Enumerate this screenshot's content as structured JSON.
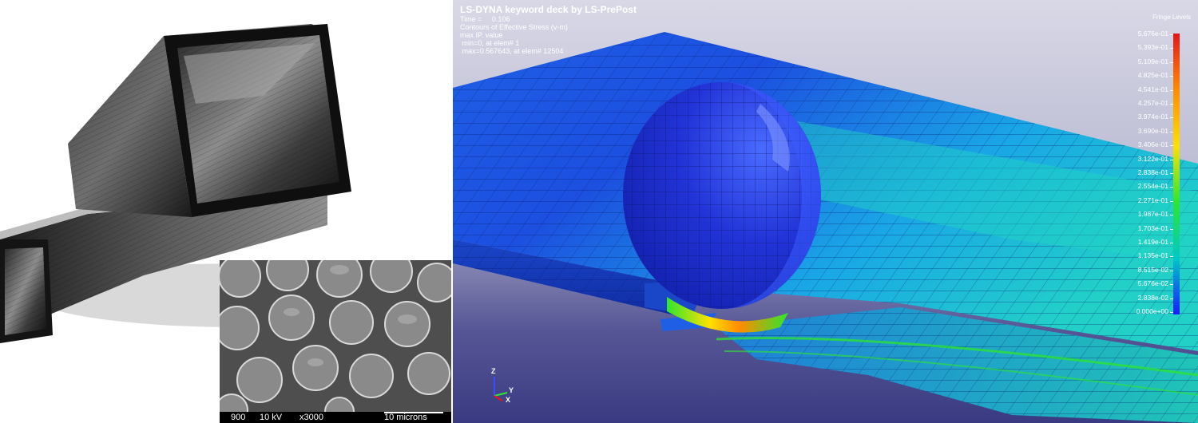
{
  "sem_caption": {
    "magnification_id": "900",
    "voltage": "10 kV",
    "zoom": "x3000",
    "scale_label": "10 microns"
  },
  "fea": {
    "title": "LS-DYNA keyword deck by LS-PrePost",
    "time_line": "Time =     0.106",
    "contours_line": "Contours of Effective Stress (v-m)",
    "value_line": "max IP. value",
    "min_line": " min=0, at elem# 1",
    "max_line": " max=0.567643, at elem# 12504",
    "fringe_title": "Fringe Levels",
    "fringe_levels": [
      "5.676e-01",
      "5.393e-01",
      "5.109e-01",
      "4.825e-01",
      "4.541e-01",
      "4.257e-01",
      "3.974e-01",
      "3.690e-01",
      "3.406e-01",
      "3.122e-01",
      "2.838e-01",
      "2.554e-01",
      "2.271e-01",
      "1.987e-01",
      "1.703e-01",
      "1.419e-01",
      "1.135e-01",
      "8.515e-02",
      "5.676e-02",
      "2.838e-02",
      "0.000e+00"
    ],
    "axis_labels": {
      "z": "Z",
      "y": "Y",
      "x": "X"
    }
  },
  "colors": {
    "fringe_max": "#e8141c",
    "fringe_high": "#ff8c00",
    "fringe_mid_high": "#ffe000",
    "fringe_mid": "#2ee62e",
    "fringe_low": "#00c8c8",
    "fringe_min": "#1a1aff",
    "plate_main": "#1f55e0",
    "sphere_main": "#2234d8"
  }
}
